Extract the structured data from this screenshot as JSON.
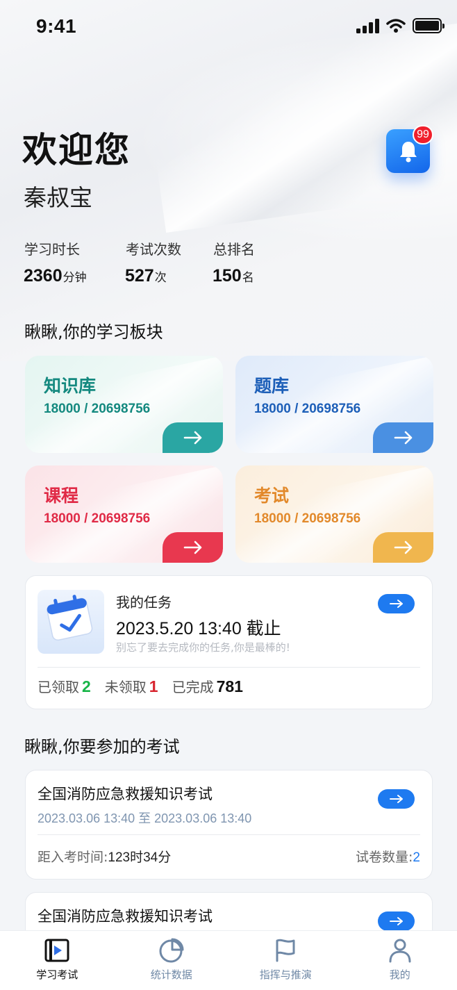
{
  "status_bar": {
    "time": "9:41"
  },
  "header": {
    "welcome": "欢迎您",
    "username": "秦叔宝",
    "notification_badge": "99"
  },
  "stats": [
    {
      "label": "学习时长",
      "value": "2360",
      "unit": "分钟"
    },
    {
      "label": "考试次数",
      "value": "527",
      "unit": "次"
    },
    {
      "label": "总排名",
      "value": "150",
      "unit": "名"
    }
  ],
  "modules_section": {
    "title": "瞅瞅,你的学习板块"
  },
  "modules": [
    {
      "title": "知识库",
      "count": "18000 / 20698756",
      "color": "#14897f"
    },
    {
      "title": "题库",
      "count": "18000 / 20698756",
      "color": "#1d5fb8"
    },
    {
      "title": "课程",
      "count": "18000 / 20698756",
      "color": "#e02a46"
    },
    {
      "title": "考试",
      "count": "18000 / 20698756",
      "color": "#e2892b"
    }
  ],
  "task": {
    "title": "我的任务",
    "deadline": "2023.5.20  13:40 截止",
    "subtitle": "别忘了要去完成你的任务,你是最棒的!",
    "received_label": "已领取",
    "received_value": "2",
    "unreceived_label": "未领取",
    "unreceived_value": "1",
    "completed_label": "已完成",
    "completed_value": "781"
  },
  "exams_section": {
    "title": "瞅瞅,你要参加的考试"
  },
  "exams": [
    {
      "title": "全国消防应急救援知识考试",
      "time": "2023.03.06 13:40 至 2023.03.06 13:40",
      "countdown_label": "距入考时间:",
      "countdown_value": "123时34分",
      "papers_label": "试卷数量:",
      "papers_value": "2"
    },
    {
      "title": "全国消防应急救援知识考试"
    }
  ],
  "tabbar": [
    {
      "label": "学习考试",
      "icon": "video-play-icon",
      "active": true
    },
    {
      "label": "统计数据",
      "icon": "pie-chart-icon",
      "active": false
    },
    {
      "label": "指挥与推演",
      "icon": "flag-icon",
      "active": false
    },
    {
      "label": "我的",
      "icon": "user-icon",
      "active": false
    }
  ],
  "colors": {
    "accent_blue": "#1e7af0",
    "received_green": "#18b548",
    "unreceived_red": "#d8252f",
    "tab_inactive": "#6f88a6"
  }
}
